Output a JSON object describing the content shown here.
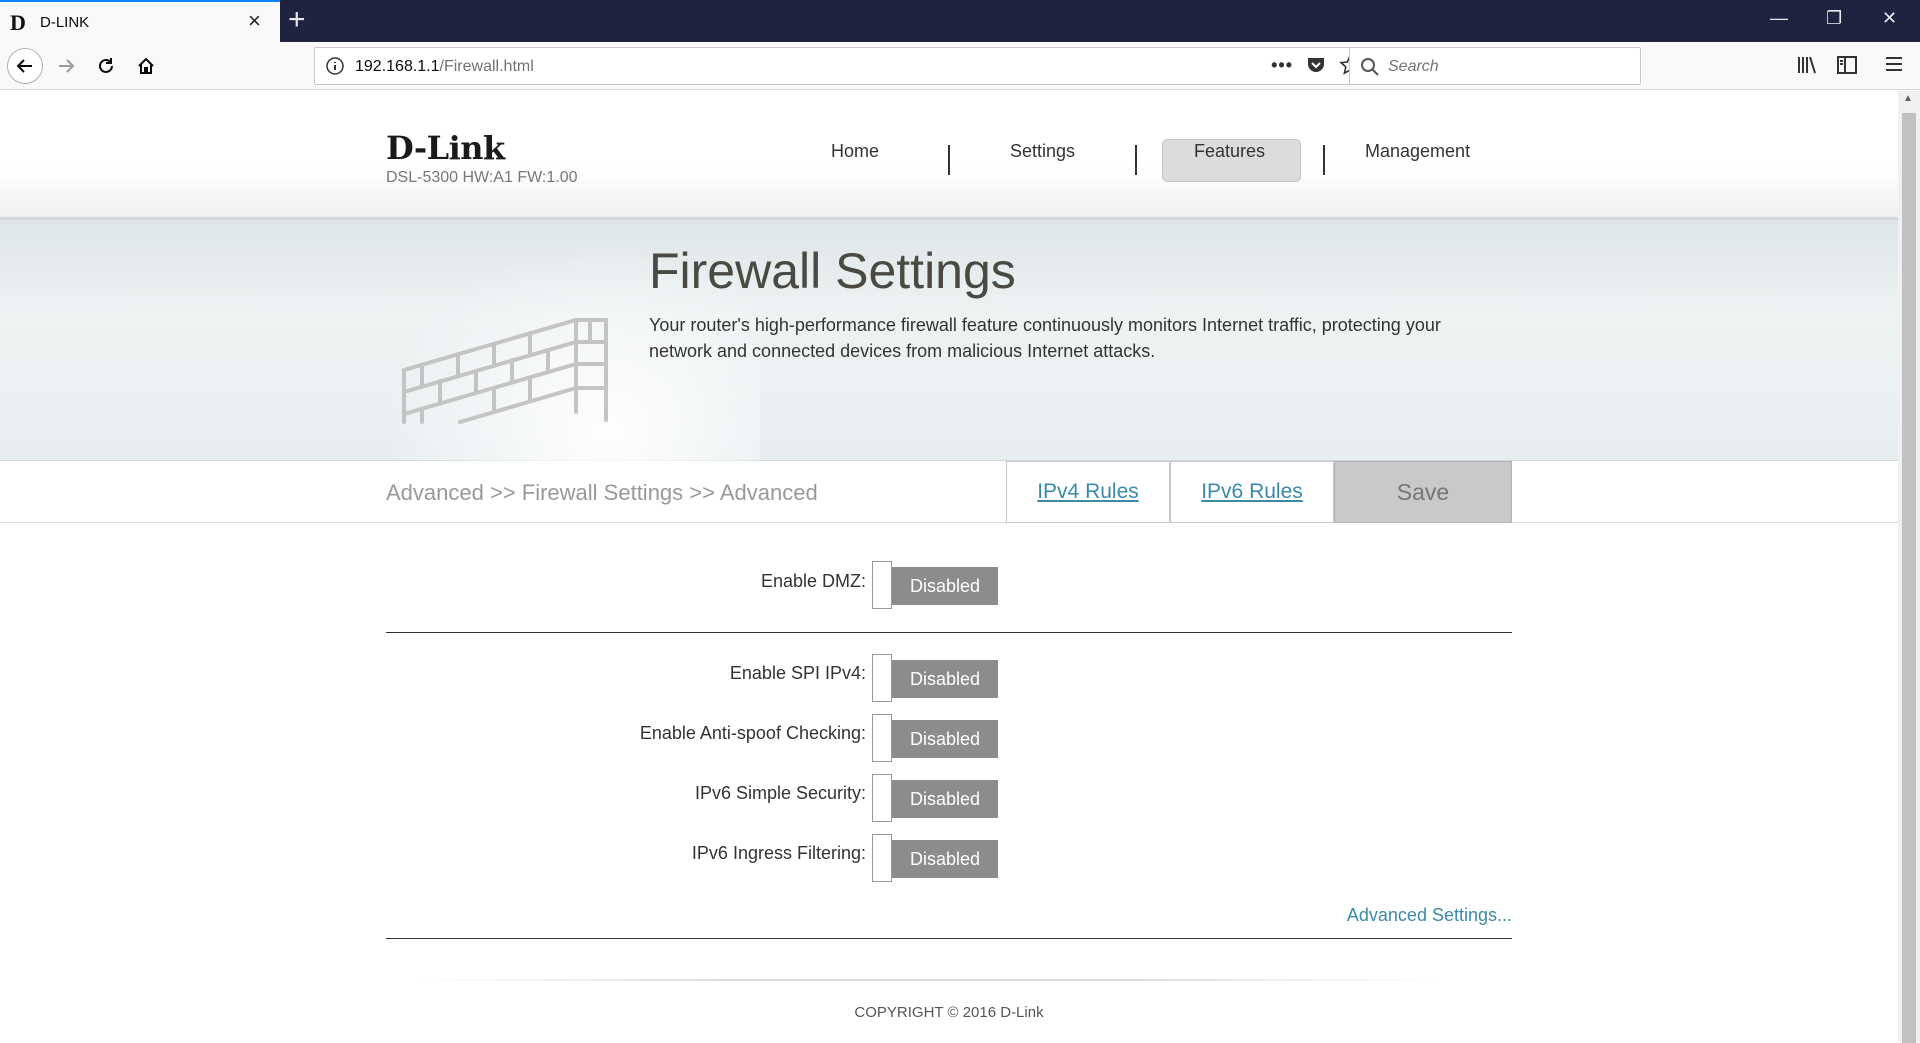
{
  "browser": {
    "tab_title": "D-LINK",
    "tab_favicon": "D",
    "url_host": "192.168.1.1",
    "url_path": "/Firewall.html",
    "search_placeholder": "Search"
  },
  "header": {
    "logo": "D-Link",
    "model": "DSL-5300 HW:A1 FW:1.00",
    "menu": [
      "Home",
      "Settings",
      "Features",
      "Management"
    ],
    "active_menu": "Features"
  },
  "banner": {
    "title": "Firewall Settings",
    "description": "Your router's high-performance firewall feature continuously monitors Internet traffic, protecting your network and connected devices from malicious Internet attacks."
  },
  "crumbbar": {
    "breadcrumb": "Advanced >> Firewall Settings >> Advanced",
    "ipv4_rules": "IPv4 Rules",
    "ipv6_rules": "IPv6 Rules",
    "save": "Save"
  },
  "settings": [
    {
      "label": "Enable DMZ:",
      "state": "Disabled"
    },
    {
      "label": "Enable SPI IPv4:",
      "state": "Disabled"
    },
    {
      "label": "Enable Anti-spoof Checking:",
      "state": "Disabled"
    },
    {
      "label": "IPv6 Simple Security:",
      "state": "Disabled"
    },
    {
      "label": "IPv6 Ingress Filtering:",
      "state": "Disabled"
    }
  ],
  "advanced_link": "Advanced Settings...",
  "footer": {
    "copyright": "COPYRIGHT © 2016 D-Link"
  },
  "colors": {
    "link": "#3a8aa8",
    "toggle_off": "#8c8c8c",
    "tab_accent": "#0a84ff"
  }
}
